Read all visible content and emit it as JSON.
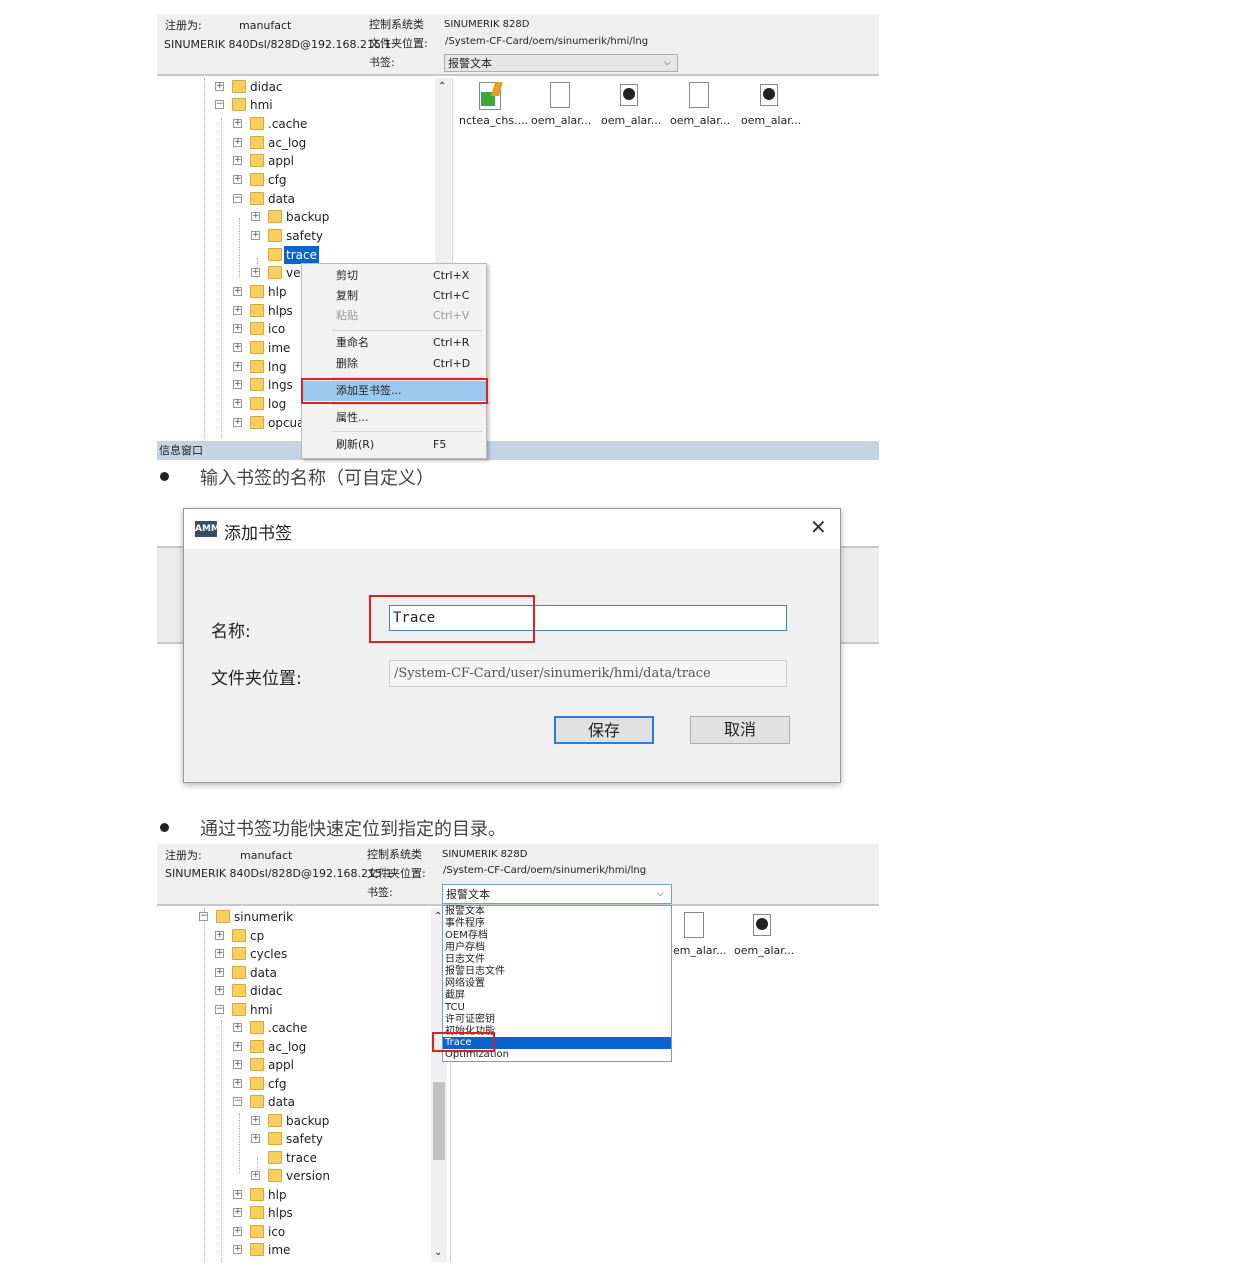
{
  "panel1": {
    "header": {
      "registered_label": "注册为:",
      "registered_value": "manufact",
      "connection": "SINUMERIK 840Dsl/828D@192.168.215.1",
      "control_label": "控制系统类",
      "control_value": "SINUMERIK 828D",
      "folder_label": "文件夹位置:",
      "folder_value": "/System-CF-Card/oem/sinumerik/hmi/lng",
      "bookmark_label": "书签:",
      "bookmark_value": "报警文本"
    },
    "tree": [
      "didac",
      "hmi",
      ".cache",
      "ac_log",
      "appl",
      "cfg",
      "data",
      "backup",
      "safety",
      "trace",
      "ver",
      "hlp",
      "hlps",
      "ico",
      "ime",
      "lng",
      "lngs",
      "log",
      "opcua"
    ],
    "files": [
      "nctea_chs....",
      "oem_alar...",
      "oem_alar...",
      "oem_alar...",
      "oem_alar..."
    ],
    "info_window": "信息窗口",
    "context_menu": {
      "cut": "剪切",
      "cut_key": "Ctrl+X",
      "copy": "复制",
      "copy_key": "Ctrl+C",
      "paste": "粘贴",
      "paste_key": "Ctrl+V",
      "rename": "重命名",
      "rename_key": "Ctrl+R",
      "delete": "删除",
      "delete_key": "Ctrl+D",
      "add_bookmark": "添加至书签...",
      "properties": "属性...",
      "refresh": "刷新(R)",
      "refresh_key": "F5"
    }
  },
  "bullet1": "输入书签的名称（可自定义）",
  "dialog": {
    "logo": "AMM",
    "title": "添加书签",
    "close": "✕",
    "name_label": "名称:",
    "name_value": "Trace",
    "folder_label": "文件夹位置:",
    "folder_value": "/System-CF-Card/user/sinumerik/hmi/data/trace",
    "save": "保存",
    "cancel": "取消"
  },
  "bullet2": "通过书签功能快速定位到指定的目录。",
  "panel2": {
    "header": {
      "registered_label": "注册为:",
      "registered_value": "manufact",
      "connection": "SINUMERIK 840Dsl/828D@192.168.215.1",
      "control_label": "控制系统类",
      "control_value": "SINUMERIK 828D",
      "folder_label": "文件夹位置:",
      "folder_value": "/System-CF-Card/oem/sinumerik/hmi/lng",
      "bookmark_label": "书签:",
      "bookmark_value": "报警文本"
    },
    "tree": [
      "sinumerik",
      "cp",
      "cycles",
      "data",
      "didac",
      "hmi",
      ".cache",
      "ac_log",
      "appl",
      "cfg",
      "data",
      "backup",
      "safety",
      "trace",
      "version",
      "hlp",
      "hlps",
      "ico",
      "ime"
    ],
    "files": [
      "em_alar...",
      "oem_alar..."
    ],
    "dropdown_options": [
      "报警文本",
      "事件程序",
      "OEM存档",
      "用户存档",
      "日志文件",
      "报警日志文件",
      "网络设置",
      "截屏",
      "TCU",
      "许可证密钥",
      "初始化功能",
      "Trace",
      "Optimization"
    ]
  },
  "colors": {
    "selection": "#0a64d0",
    "highlight_box": "#e02020",
    "menu_hover": "#99c9ef",
    "folder": "#f6cf5e"
  }
}
